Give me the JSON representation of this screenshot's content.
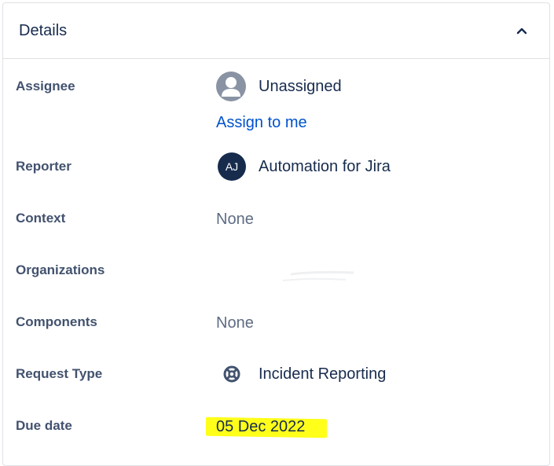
{
  "panel": {
    "title": "Details",
    "collapse_icon": "chevron-up-icon"
  },
  "fields": {
    "assignee": {
      "label": "Assignee",
      "value": "Unassigned",
      "action": "Assign to me",
      "icon": "default-avatar-icon"
    },
    "reporter": {
      "label": "Reporter",
      "value": "Automation for Jira",
      "initials": "AJ"
    },
    "context": {
      "label": "Context",
      "value": "None"
    },
    "organizations": {
      "label": "Organizations"
    },
    "components": {
      "label": "Components",
      "value": "None"
    },
    "request_type": {
      "label": "Request Type",
      "value": "Incident Reporting",
      "icon": "lifebuoy-icon"
    },
    "due_date": {
      "label": "Due date",
      "value": "05 Dec 2022",
      "highlight_color": "#ffff1a"
    }
  },
  "colors": {
    "link": "#0052cc",
    "text": "#172b4d",
    "label": "#42526e",
    "avatar_dark": "#172b4d"
  }
}
